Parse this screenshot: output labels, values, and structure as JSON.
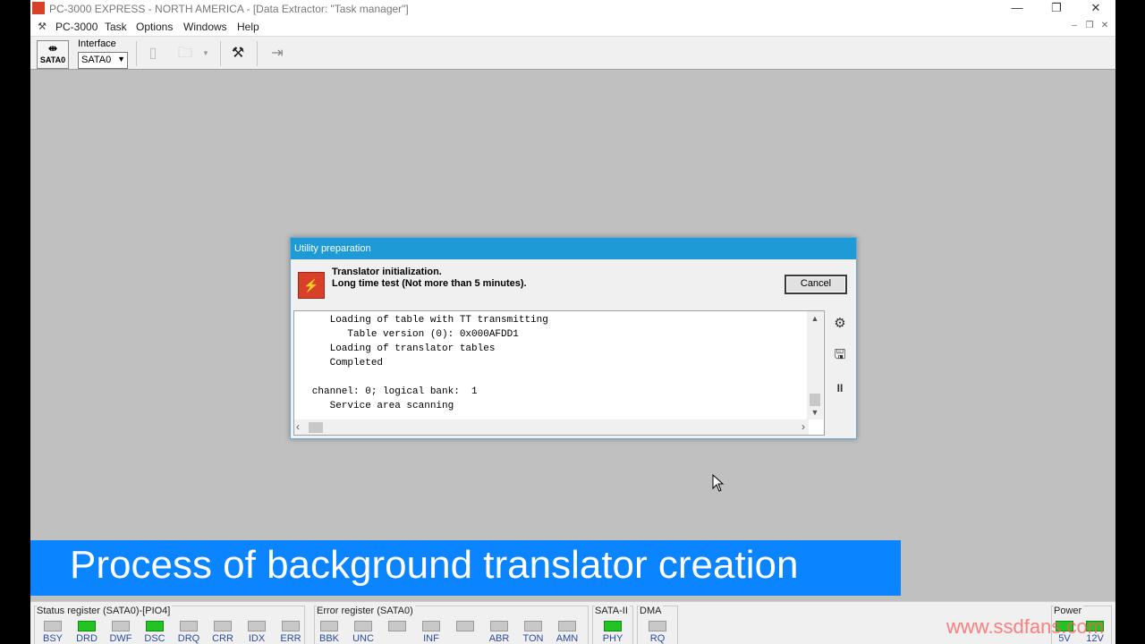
{
  "window": {
    "title": "PC-3000 EXPRESS - NORTH AMERICA - [Data Extractor: \"Task manager\"]",
    "minimize": "—",
    "maximize": "❐",
    "close": "✕"
  },
  "menu": {
    "items": [
      "PC-3000",
      "Task",
      "Options",
      "Windows",
      "Help"
    ],
    "mdi_minimize": "–",
    "mdi_restore": "❐",
    "mdi_close": "✕"
  },
  "toolbar": {
    "sata_button_label": "SATA0",
    "interface_label": "Interface",
    "interface_value": "SATA0",
    "icons": [
      "new-page-icon",
      "open-folder-icon",
      "dropdown-arrow-icon",
      "tools-icon",
      "exit-icon"
    ]
  },
  "dialog": {
    "title": "Utility preparation",
    "message_line1": "Translator initialization.",
    "message_line2": "Long time test (Not more than 5 minutes).",
    "cancel_label": "Cancel",
    "log_lines": [
      "      Loading of table with TT transmitting",
      "         Table version (0): 0x000AFDD1",
      "      Loading of translator tables",
      "      Completed",
      "",
      "   channel: 0; logical bank:  1",
      "      Service area scanning"
    ],
    "side_icons": [
      "settings-page-icon",
      "save-icon",
      "pause-icon"
    ],
    "pause_glyph": "II"
  },
  "caption": "Process of background translator creation",
  "status": {
    "status_register_label": "Status register (SATA0)-[PIO4]",
    "status_leds": [
      {
        "label": "BSY",
        "on": false
      },
      {
        "label": "DRD",
        "on": true
      },
      {
        "label": "DWF",
        "on": false
      },
      {
        "label": "DSC",
        "on": true
      },
      {
        "label": "DRQ",
        "on": false
      },
      {
        "label": "CRR",
        "on": false
      },
      {
        "label": "IDX",
        "on": false
      },
      {
        "label": "ERR",
        "on": false
      }
    ],
    "error_register_label": "Error register (SATA0)",
    "error_leds": [
      {
        "label": "BBK",
        "on": false
      },
      {
        "label": "UNC",
        "on": false
      },
      {
        "label": "",
        "on": false
      },
      {
        "label": "INF",
        "on": false
      },
      {
        "label": "",
        "on": false
      },
      {
        "label": "ABR",
        "on": false
      },
      {
        "label": "TON",
        "on": false
      },
      {
        "label": "AMN",
        "on": false
      }
    ],
    "sata_label": "SATA-II",
    "sata_led": {
      "label": "PHY",
      "on": true
    },
    "dma_label": "DMA",
    "dma_led": {
      "label": "RQ",
      "on": false
    },
    "power_label": "Power",
    "power_leds": [
      {
        "label": "5V",
        "on": true
      },
      {
        "label": "12V",
        "on": true
      }
    ]
  },
  "watermark": "www.ssdfans.com",
  "colors": {
    "dialog_title_bg": "#1e9ad6",
    "caption_bg": "#0b84ff",
    "led_on": "#22c422",
    "led_off": "#c8c8c8"
  }
}
